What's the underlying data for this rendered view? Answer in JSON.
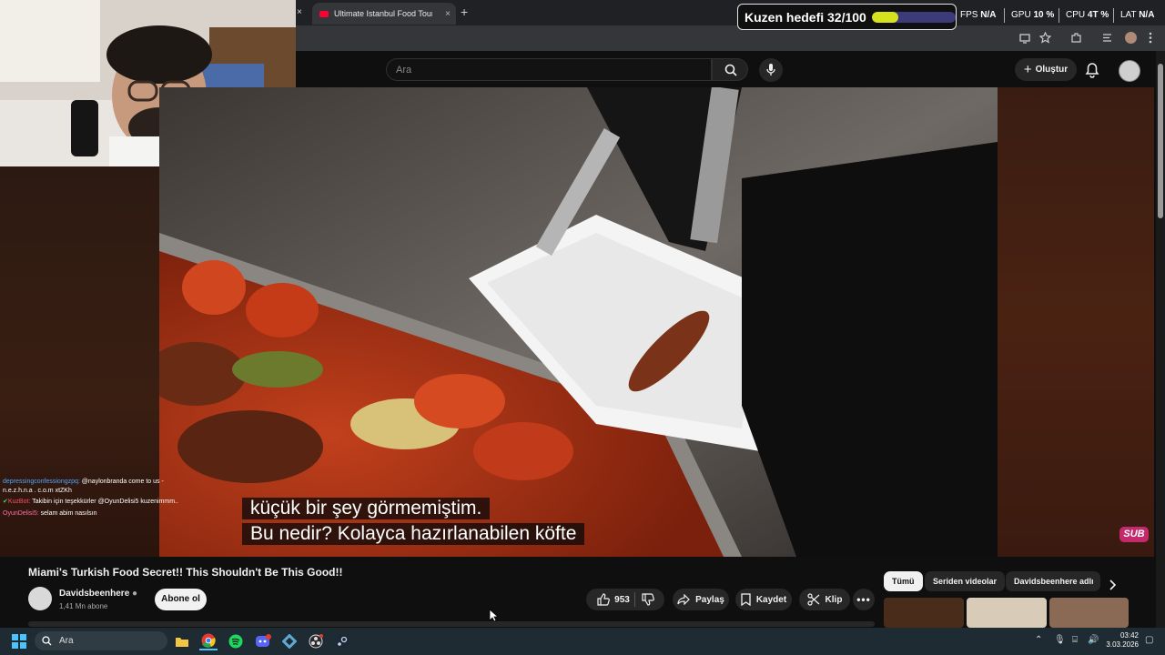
{
  "browser": {
    "tab_title": "Ultimate Istanbul Food Tour: Be",
    "tab_close": "×",
    "new_tab": "+",
    "window_close": "×"
  },
  "overlay": {
    "goal_text": "Kuzen hedefi 32/100",
    "goal_progress": 0.32,
    "fps_label": "FPS",
    "fps_value": "N/A",
    "gpu_label": "GPU",
    "gpu_value": "10 %",
    "cpu_label": "CPU",
    "cpu_value": "4T %",
    "lat_label": "LAT",
    "lat_value": "N/A"
  },
  "youtube_header": {
    "search_placeholder": "Ara",
    "create_label": "Oluştur"
  },
  "video": {
    "subtitle_line1": "küçük bir şey görmemiştim.",
    "subtitle_line2": "Bu nedir?  Kolayca hazırlanabilen köfte",
    "sub_badge": "SUB",
    "title": "Miami's Turkish Food Secret!! This Shouldn't Be This Good!!",
    "channel_name": "Davidsbeenhere",
    "channel_subs": "1,41 Mn abone",
    "subscribe_label": "Abone ol",
    "like_count": "953",
    "share_label": "Paylaş",
    "save_label": "Kaydet",
    "clip_label": "Klip"
  },
  "chat": [
    {
      "user": "depressingconfessiongzpq:",
      "user_color": "#4da3ff",
      "text": "@naylonbranda come to us - n.e.z.h.n.a . c.o.m xtZKh"
    },
    {
      "user": "KuzBot:",
      "user_color": "#ff4d6a",
      "text": "Takibin için teşekkürler @OyunDelisi5 kuzenimmm.."
    },
    {
      "user": "OyunDelisi5:",
      "user_color": "#ff6fa8",
      "text": "selam abim nasılsın"
    }
  ],
  "chips": [
    "Tümü",
    "Seriden videolar",
    "Davidsbeenhere adlı"
  ],
  "taskbar": {
    "search_label": "Ara",
    "time": "03:42",
    "date": "3.03.2026"
  },
  "colors": {
    "youtube_red": "#ff0033",
    "goal_fill": "#d6e21d",
    "goal_track": "#3d3a7a",
    "sub_badge": "#c42a6b",
    "windows_accent": "#4cc2ff"
  }
}
